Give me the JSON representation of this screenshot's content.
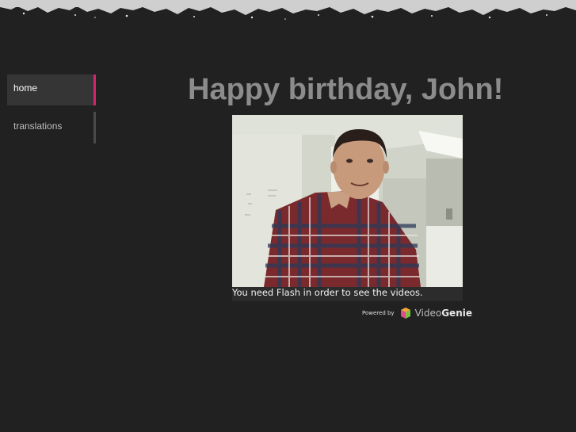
{
  "nav": {
    "items": [
      {
        "label": "home",
        "active": true
      },
      {
        "label": "translations",
        "active": false
      }
    ]
  },
  "main": {
    "title": "Happy birthday, John!",
    "video": {
      "fallback_message": "You need Flash in order to see the videos."
    },
    "powered_by": {
      "label": "Powered by",
      "brand": "Video",
      "brand_bold": "Genie"
    }
  },
  "colors": {
    "background": "#212121",
    "accent": "#d6246d",
    "title": "#8c8c8c"
  }
}
